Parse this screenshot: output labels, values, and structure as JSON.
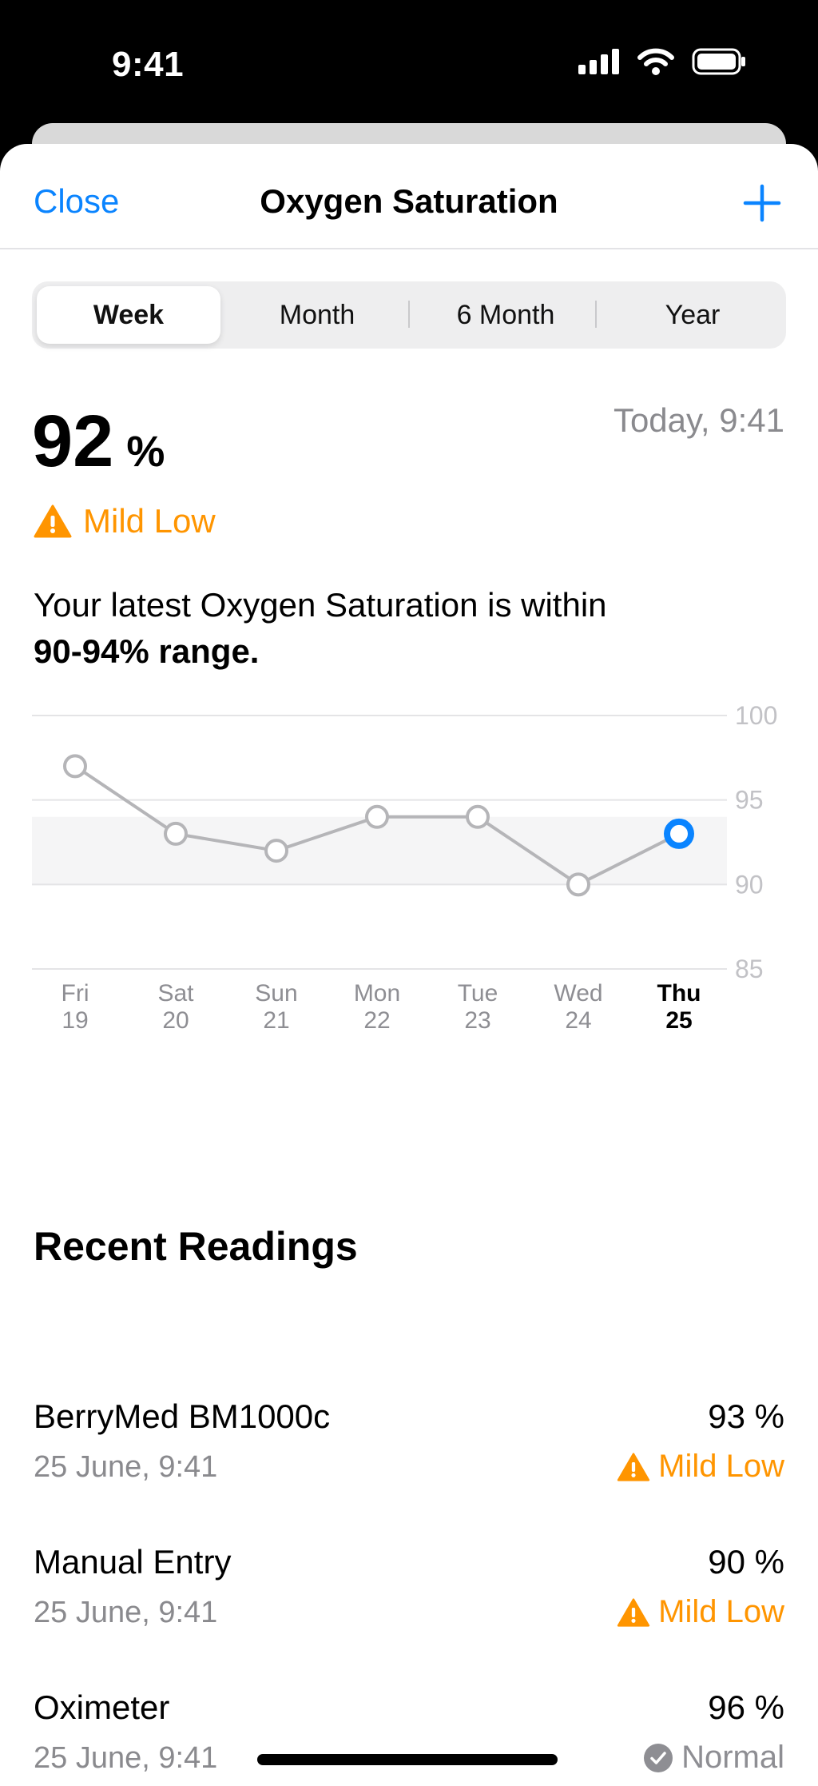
{
  "status_bar": {
    "time": "9:41"
  },
  "nav": {
    "close_label": "Close",
    "title": "Oxygen Saturation",
    "add_icon": "plus-icon"
  },
  "segments": [
    {
      "label": "Week",
      "active": true
    },
    {
      "label": "Month",
      "active": false
    },
    {
      "label": "6 Month",
      "active": false
    },
    {
      "label": "Year",
      "active": false
    }
  ],
  "summary": {
    "value": "92",
    "unit": "%",
    "timestamp": "Today, 9:41",
    "status": "Mild Low",
    "description_prefix": "Your latest Oxygen Saturation is within",
    "description_range": "90-94% range."
  },
  "colors": {
    "accent": "#0a84ff",
    "warning": "#ff9500",
    "normal": "#8e8e93",
    "line": "#b5b5b8",
    "range_band": "#f5f5f6"
  },
  "chart_data": {
    "type": "line",
    "categories": [
      "Fri 19",
      "Sat 20",
      "Sun 21",
      "Mon 22",
      "Tue 23",
      "Wed 24",
      "Thu 25"
    ],
    "x_labels": [
      {
        "day": "Fri",
        "date": "19"
      },
      {
        "day": "Sat",
        "date": "20"
      },
      {
        "day": "Sun",
        "date": "21"
      },
      {
        "day": "Mon",
        "date": "22"
      },
      {
        "day": "Tue",
        "date": "23"
      },
      {
        "day": "Wed",
        "date": "24"
      },
      {
        "day": "Thu",
        "date": "25"
      }
    ],
    "values": [
      97,
      93,
      92,
      94,
      94,
      90,
      93
    ],
    "highlight_index": 6,
    "yticks": [
      100,
      95,
      90,
      85
    ],
    "ylim": [
      85,
      100
    ],
    "range_band": [
      90,
      94
    ],
    "grid": true
  },
  "recent": {
    "title": "Recent Readings",
    "items": [
      {
        "source": "BerryMed BM1000c",
        "time": "25 June, 9:41",
        "value": "93 %",
        "status": "Mild Low",
        "status_type": "warning"
      },
      {
        "source": "Manual Entry",
        "time": "25 June, 9:41",
        "value": "90 %",
        "status": "Mild Low",
        "status_type": "warning"
      },
      {
        "source": "Oximeter",
        "time": "25 June, 9:41",
        "value": "96 %",
        "status": "Normal",
        "status_type": "normal"
      }
    ]
  }
}
